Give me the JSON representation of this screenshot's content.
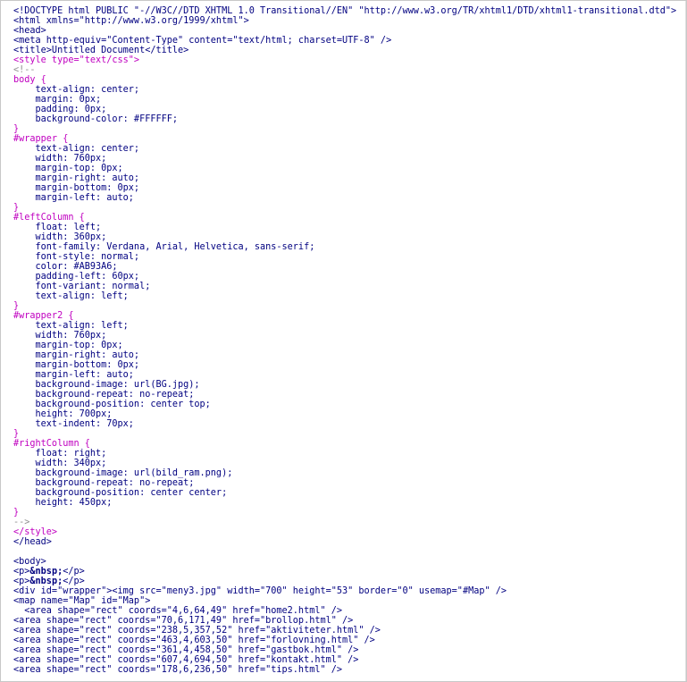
{
  "editor": {
    "lines": [
      {
        "parts": [
          {
            "t": "<!DOCTYPE html PUBLIC \"-//W3C//DTD XHTML 1.0 Transitional//EN\" \"http://www.w3.org/TR/xhtml1/DTD/xhtml1-transitional.dtd\">",
            "c": "text"
          }
        ]
      },
      {
        "parts": [
          {
            "t": "<html xmlns=\"http://www.w3.org/1999/xhtml\">",
            "c": "text"
          }
        ]
      },
      {
        "parts": [
          {
            "t": "<head>",
            "c": "text"
          }
        ]
      },
      {
        "parts": [
          {
            "t": "<meta http-equiv=\"Content-Type\" content=\"text/html; charset=UTF-8\" />",
            "c": "text"
          }
        ]
      },
      {
        "parts": [
          {
            "t": "<title>Untitled Document</title>",
            "c": "text"
          }
        ]
      },
      {
        "parts": [
          {
            "t": "<style type=\"text/css\">",
            "c": "magenta"
          }
        ]
      },
      {
        "parts": [
          {
            "t": "<!--",
            "c": "gray"
          }
        ]
      },
      {
        "parts": [
          {
            "t": "body {",
            "c": "magenta"
          }
        ]
      },
      {
        "parts": [
          {
            "t": "    text-align: center;",
            "c": "text"
          }
        ]
      },
      {
        "parts": [
          {
            "t": "    margin: 0px;",
            "c": "text"
          }
        ]
      },
      {
        "parts": [
          {
            "t": "    padding: 0px;",
            "c": "text"
          }
        ]
      },
      {
        "parts": [
          {
            "t": "    background-color: #FFFFFF;",
            "c": "text"
          }
        ]
      },
      {
        "parts": [
          {
            "t": "}",
            "c": "magenta"
          }
        ]
      },
      {
        "parts": [
          {
            "t": "#wrapper {",
            "c": "magenta"
          }
        ]
      },
      {
        "parts": [
          {
            "t": "    text-align: center;",
            "c": "text"
          }
        ]
      },
      {
        "parts": [
          {
            "t": "    width: 760px;",
            "c": "text"
          }
        ]
      },
      {
        "parts": [
          {
            "t": "    margin-top: 0px;",
            "c": "text"
          }
        ]
      },
      {
        "parts": [
          {
            "t": "    margin-right: auto;",
            "c": "text"
          }
        ]
      },
      {
        "parts": [
          {
            "t": "    margin-bottom: 0px;",
            "c": "text"
          }
        ]
      },
      {
        "parts": [
          {
            "t": "    margin-left: auto;",
            "c": "text"
          }
        ]
      },
      {
        "parts": [
          {
            "t": "}",
            "c": "magenta"
          }
        ]
      },
      {
        "parts": [
          {
            "t": "#leftColumn {",
            "c": "magenta"
          }
        ]
      },
      {
        "parts": [
          {
            "t": "    float: left;",
            "c": "text"
          }
        ]
      },
      {
        "parts": [
          {
            "t": "    width: 360px;",
            "c": "text"
          }
        ]
      },
      {
        "parts": [
          {
            "t": "    font-family: Verdana, Arial, Helvetica, sans-serif;",
            "c": "text"
          }
        ]
      },
      {
        "parts": [
          {
            "t": "    font-style: normal;",
            "c": "text"
          }
        ]
      },
      {
        "parts": [
          {
            "t": "    color: #AB93A6;",
            "c": "text"
          }
        ]
      },
      {
        "parts": [
          {
            "t": "    padding-left: 60px;",
            "c": "text"
          }
        ]
      },
      {
        "parts": [
          {
            "t": "    font-variant: normal;",
            "c": "text"
          }
        ]
      },
      {
        "parts": [
          {
            "t": "    text-align: left;",
            "c": "text"
          }
        ]
      },
      {
        "parts": [
          {
            "t": "}",
            "c": "magenta"
          }
        ]
      },
      {
        "parts": [
          {
            "t": "#wrapper2 {",
            "c": "magenta"
          }
        ]
      },
      {
        "parts": [
          {
            "t": "    text-align: left;",
            "c": "text"
          }
        ]
      },
      {
        "parts": [
          {
            "t": "    width: 760px;",
            "c": "text"
          }
        ]
      },
      {
        "parts": [
          {
            "t": "    margin-top: 0px;",
            "c": "text"
          }
        ]
      },
      {
        "parts": [
          {
            "t": "    margin-right: auto;",
            "c": "text"
          }
        ]
      },
      {
        "parts": [
          {
            "t": "    margin-bottom: 0px;",
            "c": "text"
          }
        ]
      },
      {
        "parts": [
          {
            "t": "    margin-left: auto;",
            "c": "text"
          }
        ]
      },
      {
        "parts": [
          {
            "t": "    background-image: url(BG.jpg);",
            "c": "text"
          }
        ]
      },
      {
        "parts": [
          {
            "t": "    background-repeat: no-repeat;",
            "c": "text"
          }
        ]
      },
      {
        "parts": [
          {
            "t": "    background-position: center top;",
            "c": "text"
          }
        ]
      },
      {
        "parts": [
          {
            "t": "    height: 700px;",
            "c": "text"
          }
        ]
      },
      {
        "parts": [
          {
            "t": "    text-indent: 70px;",
            "c": "text"
          }
        ]
      },
      {
        "parts": [
          {
            "t": "}",
            "c": "magenta"
          }
        ]
      },
      {
        "parts": [
          {
            "t": "#rightColumn {",
            "c": "magenta"
          }
        ]
      },
      {
        "parts": [
          {
            "t": "    float: right;",
            "c": "text"
          }
        ]
      },
      {
        "parts": [
          {
            "t": "    width: 340px;",
            "c": "text"
          }
        ]
      },
      {
        "parts": [
          {
            "t": "    background-image: url(bild_ram.png);",
            "c": "text"
          }
        ]
      },
      {
        "parts": [
          {
            "t": "    background-repeat: no-repeat;",
            "c": "text"
          }
        ]
      },
      {
        "parts": [
          {
            "t": "    background-position: center center;",
            "c": "text"
          }
        ]
      },
      {
        "parts": [
          {
            "t": "    height: 450px;",
            "c": "text"
          }
        ]
      },
      {
        "parts": [
          {
            "t": "}",
            "c": "magenta"
          }
        ]
      },
      {
        "parts": [
          {
            "t": "-->",
            "c": "gray"
          }
        ]
      },
      {
        "parts": [
          {
            "t": "</style>",
            "c": "magenta"
          }
        ]
      },
      {
        "parts": [
          {
            "t": "</head>",
            "c": "text"
          }
        ]
      },
      {
        "parts": [
          {
            "t": "",
            "c": "text"
          }
        ]
      },
      {
        "parts": [
          {
            "t": "<body>",
            "c": "text"
          }
        ]
      },
      {
        "parts": [
          {
            "t": "<p>",
            "c": "text"
          },
          {
            "t": "&nbsp;",
            "c": "bold"
          },
          {
            "t": "</p>",
            "c": "text"
          }
        ]
      },
      {
        "parts": [
          {
            "t": "<p>",
            "c": "text"
          },
          {
            "t": "&nbsp;",
            "c": "bold"
          },
          {
            "t": "</p>",
            "c": "text"
          }
        ]
      },
      {
        "parts": [
          {
            "t": "<div id=\"wrapper\"><img src=\"meny3.jpg\" width=\"700\" height=\"53\" border=\"0\" usemap=\"#Map\" />",
            "c": "text"
          }
        ]
      },
      {
        "parts": [
          {
            "t": "<map name=\"Map\" id=\"Map\">",
            "c": "text"
          }
        ]
      },
      {
        "parts": [
          {
            "t": "  <area shape=\"rect\" coords=\"4,6,64,49\" href=\"home2.html\" />",
            "c": "text"
          }
        ]
      },
      {
        "parts": [
          {
            "t": "<area shape=\"rect\" coords=\"70,6,171,49\" href=\"brollop.html\" />",
            "c": "text"
          }
        ]
      },
      {
        "parts": [
          {
            "t": "<area shape=\"rect\" coords=\"238,5,357,52\" href=\"aktiviteter.html\" />",
            "c": "text"
          }
        ]
      },
      {
        "parts": [
          {
            "t": "<area shape=\"rect\" coords=\"463,4,603,50\" href=\"forlovning.html\" />",
            "c": "text"
          }
        ]
      },
      {
        "parts": [
          {
            "t": "<area shape=\"rect\" coords=\"361,4,458,50\" href=\"gastbok.html\" />",
            "c": "text"
          }
        ]
      },
      {
        "parts": [
          {
            "t": "<area shape=\"rect\" coords=\"607,4,694,50\" href=\"kontakt.html\" />",
            "c": "text"
          }
        ]
      },
      {
        "parts": [
          {
            "t": "<area shape=\"rect\" coords=\"178,6,236,50\" href=\"tips.html\" />",
            "c": "text"
          }
        ]
      }
    ]
  }
}
